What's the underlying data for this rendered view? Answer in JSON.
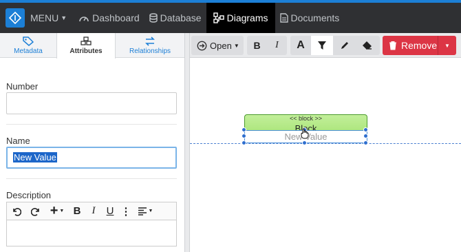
{
  "nav": {
    "menu_label": "MENU",
    "items": [
      {
        "label": "Dashboard",
        "icon": "dashboard-icon"
      },
      {
        "label": "Database",
        "icon": "database-icon"
      },
      {
        "label": "Diagrams",
        "icon": "diagrams-icon",
        "active": true
      },
      {
        "label": "Documents",
        "icon": "document-icon"
      }
    ]
  },
  "left_tabs": [
    {
      "label": "Metadata",
      "icon": "tag-icon"
    },
    {
      "label": "Attributes",
      "icon": "cubes-icon",
      "active": true
    },
    {
      "label": "Relationships",
      "icon": "exchange-icon"
    }
  ],
  "form": {
    "number_label": "Number",
    "number_value": "",
    "name_label": "Name",
    "name_value": "New Value",
    "description_label": "Description"
  },
  "toolbar": {
    "open_label": "Open",
    "remove_label": "Remove"
  },
  "diagram": {
    "block_stereotype": "<< block >>",
    "block_name": "Block",
    "attribute_value": "New Value"
  },
  "colors": {
    "accent": "#1c7fd6",
    "nav_bg": "#2f3033",
    "block_fill": "#a8e47a",
    "remove_red": "#dc3545"
  }
}
